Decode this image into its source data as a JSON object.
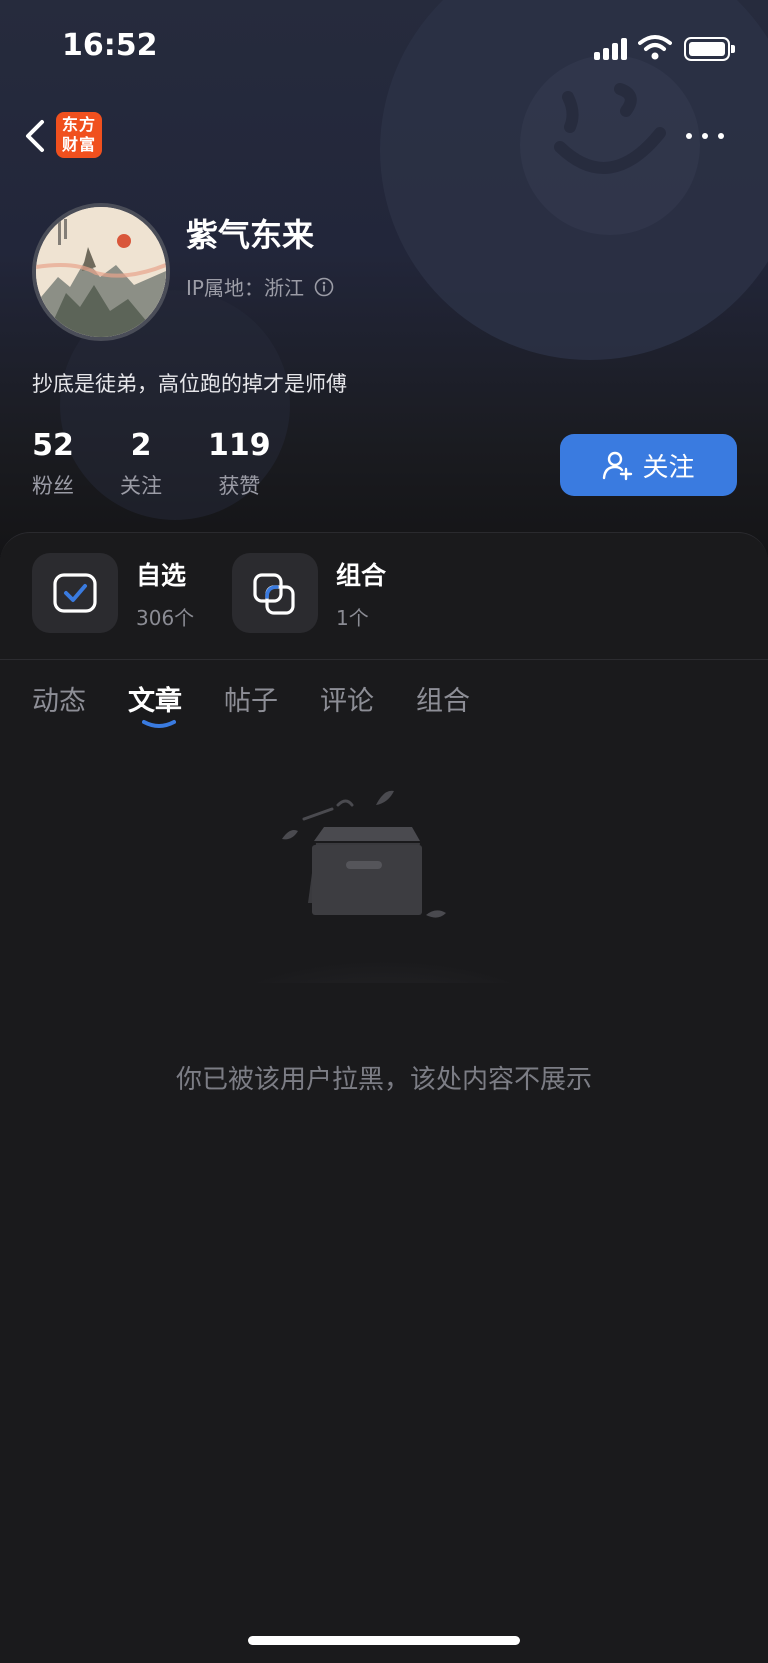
{
  "status_bar": {
    "time": "16:52"
  },
  "nav": {
    "logo_line1": "东方",
    "logo_line2": "财富"
  },
  "profile": {
    "name": "紫气东来",
    "ip_location": "IP属地：浙江",
    "bio": "抄底是徒弟，高位跑的掉才是师傅",
    "stats": [
      {
        "value": "52",
        "label": "粉丝"
      },
      {
        "value": "2",
        "label": "关注"
      },
      {
        "value": "119",
        "label": "获赞"
      }
    ],
    "follow_label": "关注"
  },
  "quick_links": [
    {
      "title": "自选",
      "count": "306个",
      "icon": "checkbox-icon"
    },
    {
      "title": "组合",
      "count": "1个",
      "icon": "portfolio-icon"
    }
  ],
  "tabs": [
    {
      "label": "动态",
      "active": false
    },
    {
      "label": "文章",
      "active": true
    },
    {
      "label": "帖子",
      "active": false
    },
    {
      "label": "评论",
      "active": false
    },
    {
      "label": "组合",
      "active": false
    }
  ],
  "empty_message": "你已被该用户拉黑，该处内容不展示",
  "colors": {
    "accent": "#3a7be0",
    "logo": "#f0501e",
    "background": "#18181a"
  }
}
